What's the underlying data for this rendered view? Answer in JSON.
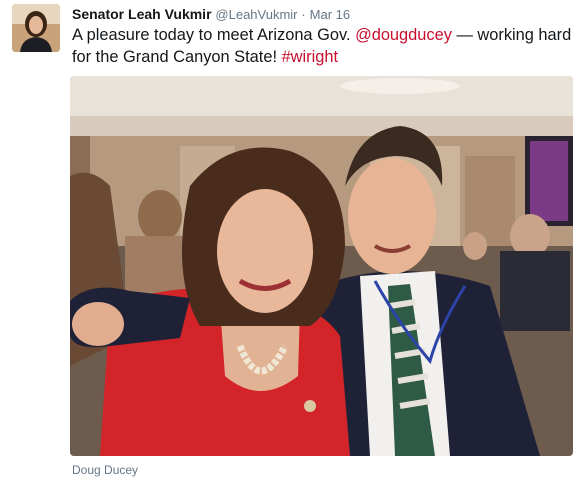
{
  "author": {
    "name": "Senator Leah Vukmir",
    "handle": "@LeahVukmir",
    "separator": "·",
    "timestamp": "Mar 16"
  },
  "tweet": {
    "text_before": "A pleasure today to meet Arizona Gov. ",
    "mention": "@dougducey",
    "text_after": " — working hard for the Grand Canyon State! ",
    "hashtag": "#wiright"
  },
  "media": {
    "caption": "Doug Ducey"
  },
  "colors": {
    "link": "#c8102e",
    "secondary_text": "#657786"
  }
}
